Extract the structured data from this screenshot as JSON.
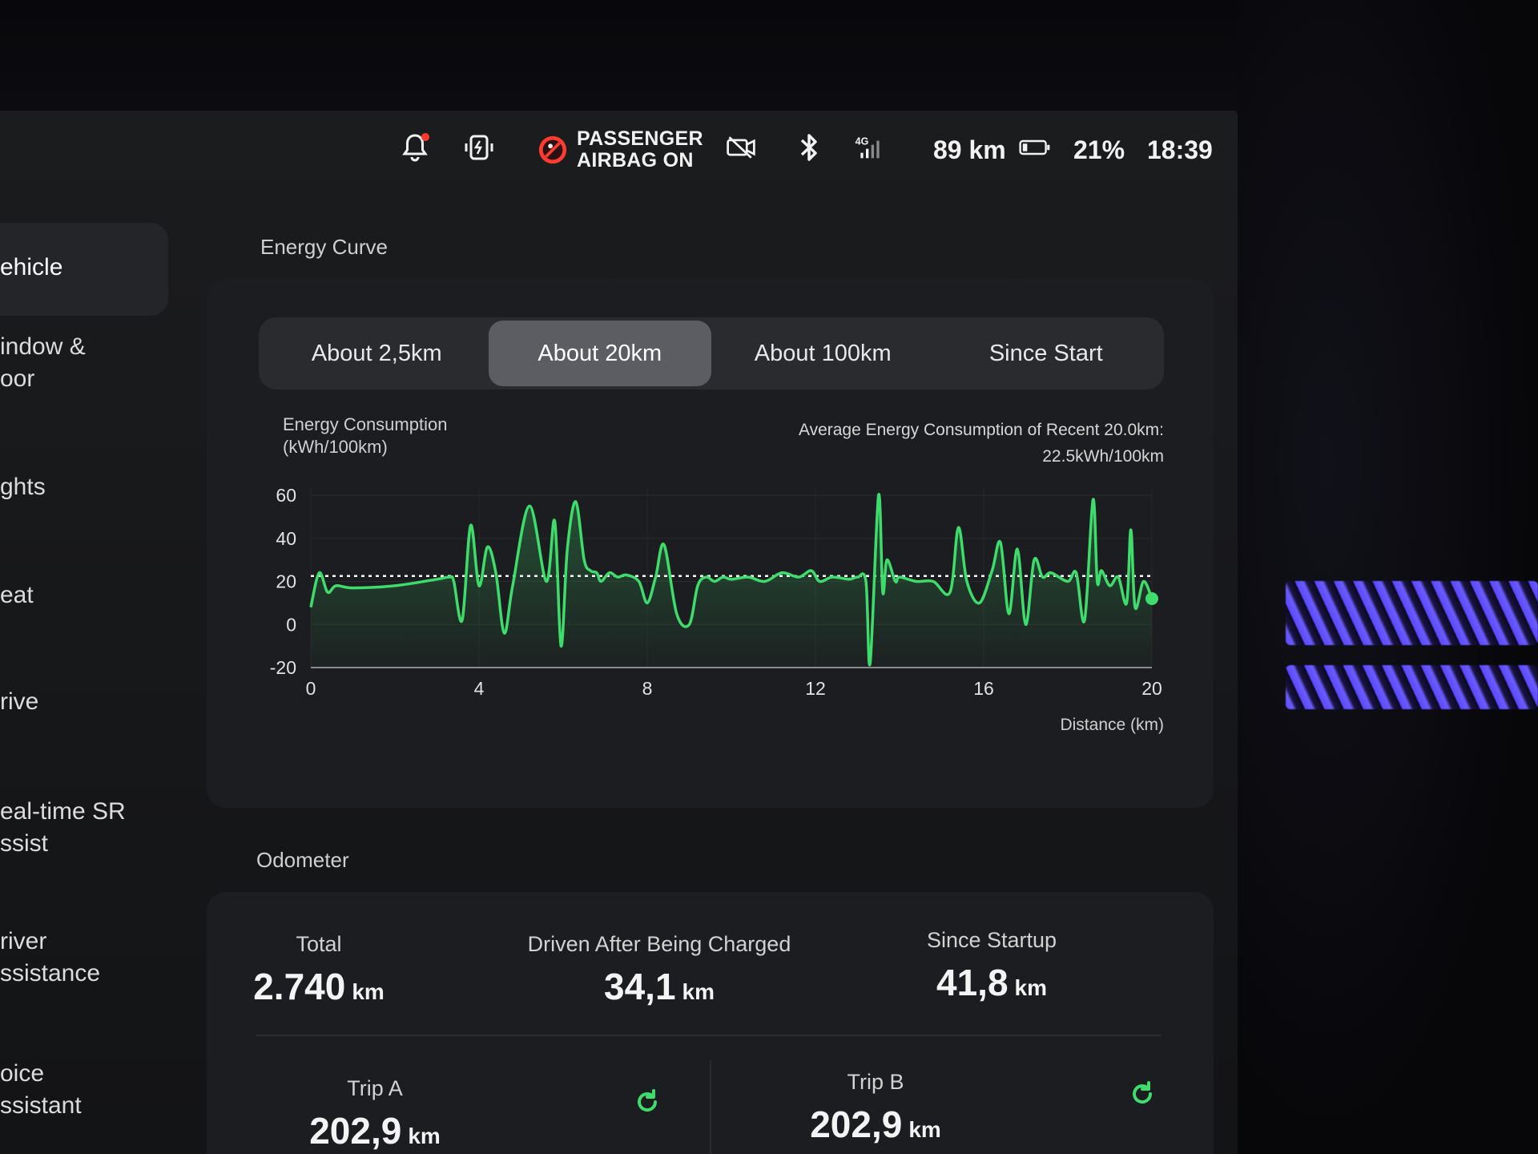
{
  "status_bar": {
    "airbag_line1": "PASSENGER",
    "airbag_line2": "AIRBAG ON",
    "range": "89 km",
    "battery_percent": "21%",
    "time": "18:39",
    "network": "4G",
    "icons": [
      "bell-icon",
      "phone-charging-icon",
      "airbag-off-icon",
      "camera-off-icon",
      "bluetooth-icon",
      "signal-icon",
      "battery-icon"
    ],
    "notification_dot_color": "#ff3b30"
  },
  "sidebar": {
    "items": [
      {
        "label": "ehicle",
        "active": true
      },
      {
        "label": "indow &\noor"
      },
      {
        "label": "ghts"
      },
      {
        "label": "eat"
      },
      {
        "label": "rive"
      },
      {
        "label": "eal-time SR\nssist"
      },
      {
        "label": "river\nssistance"
      },
      {
        "label": "oice\nssistant"
      }
    ]
  },
  "energy": {
    "title": "Energy Curve",
    "tabs": [
      "About 2,5km",
      "About 20km",
      "About 100km",
      "Since Start"
    ],
    "active_tab": 1,
    "ylabel_line1": "Energy Consumption",
    "ylabel_line2": "(kWh/100km)",
    "avg_line1": "Average Energy Consumption of Recent 20.0km:",
    "avg_line2": "22.5kWh/100km",
    "xlabel": "Distance (km)"
  },
  "chart_data": {
    "type": "line",
    "xlabel": "Distance (km)",
    "ylabel": "Energy Consumption (kWh/100km)",
    "xlim": [
      0,
      20
    ],
    "ylim": [
      -20,
      60
    ],
    "xticks": [
      0,
      4,
      8,
      12,
      16,
      20
    ],
    "yticks": [
      60,
      40,
      20,
      0,
      -20
    ],
    "average_line": 22.5,
    "line_color": "#3ddc6b",
    "grid": true,
    "series": [
      {
        "x": [
          0,
          0.2,
          0.4,
          0.6,
          1,
          2,
          3,
          3.3,
          3.4,
          3.6,
          3.8,
          4,
          4.2,
          4.4,
          4.6,
          4.8,
          5.2,
          5.6,
          5.8,
          5.95,
          6.1,
          6.3,
          6.5,
          6.65,
          6.8,
          6.9,
          7.1,
          7.3,
          7.5,
          7.8,
          8.0,
          8.2,
          8.4,
          8.7,
          9.0,
          9.2,
          9.4,
          9.6,
          9.8,
          10,
          10.4,
          10.8,
          11.2,
          11.6,
          11.9,
          12.1,
          12.4,
          12.8,
          13.0,
          13.2,
          13.3,
          13.5,
          13.6,
          13.7,
          13.9,
          14.0,
          14.4,
          14.8,
          15.2,
          15.4,
          15.6,
          15.9,
          16.2,
          16.4,
          16.6,
          16.8,
          17.0,
          17.2,
          17.4,
          17.6,
          18.0,
          18.2,
          18.4,
          18.6,
          18.7,
          18.8,
          19.0,
          19.2,
          19.4,
          19.5,
          19.6,
          19.8,
          20.0
        ],
        "y": [
          8,
          24,
          15,
          18,
          17,
          18,
          21,
          22,
          20,
          2,
          46,
          18,
          36,
          24,
          -4,
          18,
          55,
          20,
          48,
          -10,
          35,
          57,
          30,
          25,
          24,
          20,
          24,
          22,
          23,
          20,
          10,
          22,
          37,
          5,
          0,
          18,
          22,
          20,
          22,
          21,
          22,
          20,
          24,
          22,
          25,
          20,
          22,
          21,
          22,
          20,
          -18,
          60,
          15,
          30,
          20,
          22,
          20,
          20,
          15,
          45,
          20,
          10,
          25,
          38,
          5,
          35,
          0,
          30,
          22,
          24,
          20,
          24,
          2,
          58,
          20,
          25,
          18,
          22,
          10,
          44,
          8,
          20,
          12
        ]
      }
    ]
  },
  "odometer": {
    "title": "Odometer",
    "total_label": "Total",
    "total_value": "2.740",
    "charged_label": "Driven After Being Charged",
    "charged_value": "34,1",
    "startup_label": "Since Startup",
    "startup_value": "41,8",
    "trip_a_label": "Trip A",
    "trip_a_value": "202,9",
    "trip_b_label": "Trip B",
    "trip_b_value": "202,9",
    "unit": "km",
    "reset_color": "#3ddc6b"
  }
}
